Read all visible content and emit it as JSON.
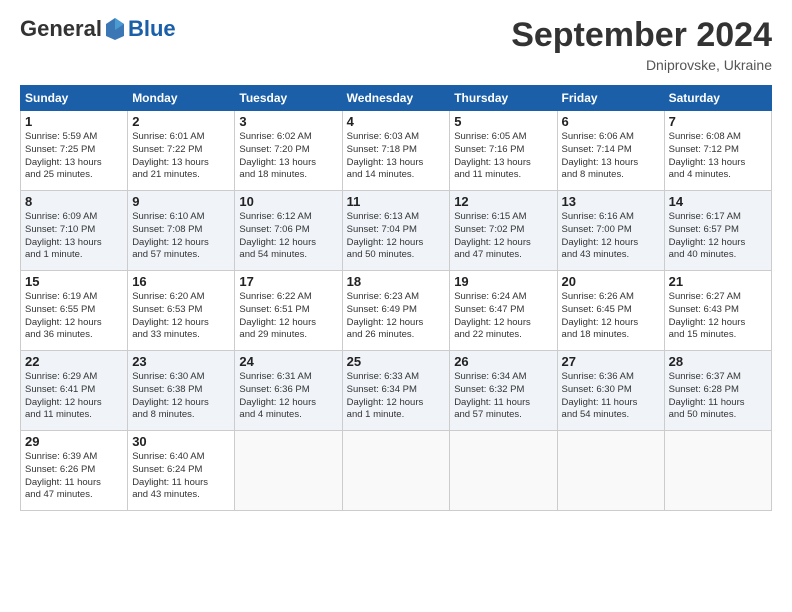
{
  "header": {
    "logo_general": "General",
    "logo_blue": "Blue",
    "month_title": "September 2024",
    "location": "Dniprovske, Ukraine"
  },
  "weekdays": [
    "Sunday",
    "Monday",
    "Tuesday",
    "Wednesday",
    "Thursday",
    "Friday",
    "Saturday"
  ],
  "weeks": [
    [
      {
        "day": "1",
        "info": "Sunrise: 5:59 AM\nSunset: 7:25 PM\nDaylight: 13 hours\nand 25 minutes."
      },
      {
        "day": "2",
        "info": "Sunrise: 6:01 AM\nSunset: 7:22 PM\nDaylight: 13 hours\nand 21 minutes."
      },
      {
        "day": "3",
        "info": "Sunrise: 6:02 AM\nSunset: 7:20 PM\nDaylight: 13 hours\nand 18 minutes."
      },
      {
        "day": "4",
        "info": "Sunrise: 6:03 AM\nSunset: 7:18 PM\nDaylight: 13 hours\nand 14 minutes."
      },
      {
        "day": "5",
        "info": "Sunrise: 6:05 AM\nSunset: 7:16 PM\nDaylight: 13 hours\nand 11 minutes."
      },
      {
        "day": "6",
        "info": "Sunrise: 6:06 AM\nSunset: 7:14 PM\nDaylight: 13 hours\nand 8 minutes."
      },
      {
        "day": "7",
        "info": "Sunrise: 6:08 AM\nSunset: 7:12 PM\nDaylight: 13 hours\nand 4 minutes."
      }
    ],
    [
      {
        "day": "8",
        "info": "Sunrise: 6:09 AM\nSunset: 7:10 PM\nDaylight: 13 hours\nand 1 minute."
      },
      {
        "day": "9",
        "info": "Sunrise: 6:10 AM\nSunset: 7:08 PM\nDaylight: 12 hours\nand 57 minutes."
      },
      {
        "day": "10",
        "info": "Sunrise: 6:12 AM\nSunset: 7:06 PM\nDaylight: 12 hours\nand 54 minutes."
      },
      {
        "day": "11",
        "info": "Sunrise: 6:13 AM\nSunset: 7:04 PM\nDaylight: 12 hours\nand 50 minutes."
      },
      {
        "day": "12",
        "info": "Sunrise: 6:15 AM\nSunset: 7:02 PM\nDaylight: 12 hours\nand 47 minutes."
      },
      {
        "day": "13",
        "info": "Sunrise: 6:16 AM\nSunset: 7:00 PM\nDaylight: 12 hours\nand 43 minutes."
      },
      {
        "day": "14",
        "info": "Sunrise: 6:17 AM\nSunset: 6:57 PM\nDaylight: 12 hours\nand 40 minutes."
      }
    ],
    [
      {
        "day": "15",
        "info": "Sunrise: 6:19 AM\nSunset: 6:55 PM\nDaylight: 12 hours\nand 36 minutes."
      },
      {
        "day": "16",
        "info": "Sunrise: 6:20 AM\nSunset: 6:53 PM\nDaylight: 12 hours\nand 33 minutes."
      },
      {
        "day": "17",
        "info": "Sunrise: 6:22 AM\nSunset: 6:51 PM\nDaylight: 12 hours\nand 29 minutes."
      },
      {
        "day": "18",
        "info": "Sunrise: 6:23 AM\nSunset: 6:49 PM\nDaylight: 12 hours\nand 26 minutes."
      },
      {
        "day": "19",
        "info": "Sunrise: 6:24 AM\nSunset: 6:47 PM\nDaylight: 12 hours\nand 22 minutes."
      },
      {
        "day": "20",
        "info": "Sunrise: 6:26 AM\nSunset: 6:45 PM\nDaylight: 12 hours\nand 18 minutes."
      },
      {
        "day": "21",
        "info": "Sunrise: 6:27 AM\nSunset: 6:43 PM\nDaylight: 12 hours\nand 15 minutes."
      }
    ],
    [
      {
        "day": "22",
        "info": "Sunrise: 6:29 AM\nSunset: 6:41 PM\nDaylight: 12 hours\nand 11 minutes."
      },
      {
        "day": "23",
        "info": "Sunrise: 6:30 AM\nSunset: 6:38 PM\nDaylight: 12 hours\nand 8 minutes."
      },
      {
        "day": "24",
        "info": "Sunrise: 6:31 AM\nSunset: 6:36 PM\nDaylight: 12 hours\nand 4 minutes."
      },
      {
        "day": "25",
        "info": "Sunrise: 6:33 AM\nSunset: 6:34 PM\nDaylight: 12 hours\nand 1 minute."
      },
      {
        "day": "26",
        "info": "Sunrise: 6:34 AM\nSunset: 6:32 PM\nDaylight: 11 hours\nand 57 minutes."
      },
      {
        "day": "27",
        "info": "Sunrise: 6:36 AM\nSunset: 6:30 PM\nDaylight: 11 hours\nand 54 minutes."
      },
      {
        "day": "28",
        "info": "Sunrise: 6:37 AM\nSunset: 6:28 PM\nDaylight: 11 hours\nand 50 minutes."
      }
    ],
    [
      {
        "day": "29",
        "info": "Sunrise: 6:39 AM\nSunset: 6:26 PM\nDaylight: 11 hours\nand 47 minutes."
      },
      {
        "day": "30",
        "info": "Sunrise: 6:40 AM\nSunset: 6:24 PM\nDaylight: 11 hours\nand 43 minutes."
      },
      {
        "day": "",
        "info": ""
      },
      {
        "day": "",
        "info": ""
      },
      {
        "day": "",
        "info": ""
      },
      {
        "day": "",
        "info": ""
      },
      {
        "day": "",
        "info": ""
      }
    ]
  ]
}
